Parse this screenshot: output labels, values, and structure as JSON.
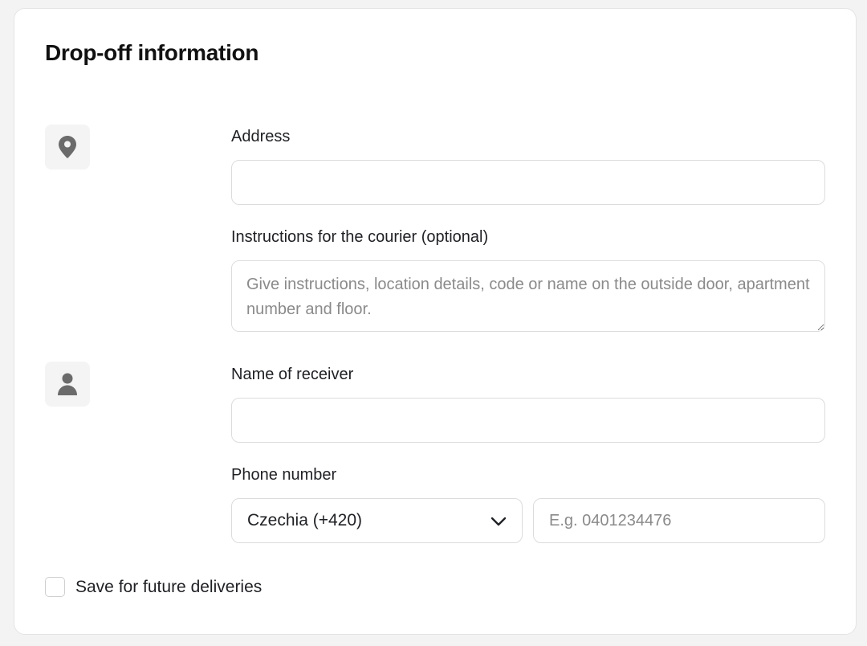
{
  "title": "Drop-off information",
  "address": {
    "icon": "location-pin-icon",
    "label": "Address",
    "value": "",
    "placeholder": ""
  },
  "instructions": {
    "label": "Instructions for the courier (optional)",
    "value": "",
    "placeholder": "Give instructions, location details, code or name on the outside door, apartment number and floor."
  },
  "receiver": {
    "icon": "person-icon",
    "label": "Name of receiver",
    "value": "",
    "placeholder": ""
  },
  "phone": {
    "label": "Phone number",
    "country_selected": "Czechia (+420)",
    "number_value": "",
    "number_placeholder": "E.g. 0401234476"
  },
  "save_option": {
    "label": "Save for future deliveries",
    "checked": false
  },
  "colors": {
    "icon": "#6b6b6b",
    "icon_bg": "#f4f4f4",
    "border": "#dcdcdc",
    "text": "#202125",
    "placeholder": "#8a8a8a"
  }
}
